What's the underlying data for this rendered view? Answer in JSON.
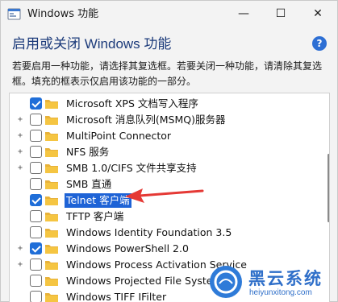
{
  "window": {
    "title": "Windows 功能",
    "buttons": {
      "minimize": "—",
      "maximize": "☐",
      "close": "✕"
    }
  },
  "header": {
    "title": "启用或关闭 Windows 功能",
    "help": "?",
    "description": "若要启用一种功能，请选择其复选框。若要关闭一种功能，请清除其复选框。填充的框表示仅启用该功能的一部分。"
  },
  "features": [
    {
      "label": "Microsoft XPS 文档写入程序",
      "checked": true,
      "expandable": false
    },
    {
      "label": "Microsoft 消息队列(MSMQ)服务器",
      "checked": false,
      "expandable": true
    },
    {
      "label": "MultiPoint Connector",
      "checked": false,
      "expandable": true
    },
    {
      "label": "NFS 服务",
      "checked": false,
      "expandable": true
    },
    {
      "label": "SMB 1.0/CIFS 文件共享支持",
      "checked": false,
      "expandable": true
    },
    {
      "label": "SMB 直通",
      "checked": false,
      "expandable": false
    },
    {
      "label": "Telnet 客户端",
      "checked": true,
      "expandable": false,
      "selected": true
    },
    {
      "label": "TFTP 客户端",
      "checked": false,
      "expandable": false
    },
    {
      "label": "Windows Identity Foundation 3.5",
      "checked": false,
      "expandable": false
    },
    {
      "label": "Windows PowerShell 2.0",
      "checked": true,
      "expandable": true
    },
    {
      "label": "Windows Process Activation Service",
      "checked": false,
      "expandable": true
    },
    {
      "label": "Windows Projected File System",
      "checked": false,
      "expandable": false
    },
    {
      "label": "Windows TIFF IFilter",
      "checked": false,
      "expandable": false
    }
  ],
  "watermark": {
    "name": "黑云系统",
    "url": "heiyunxitong.com"
  },
  "colors": {
    "accent": "#1f6ed8",
    "selection": "#1e63d6",
    "header_title": "#1b3a7a",
    "arrow": "#e53935",
    "folder": "#f5c542"
  }
}
